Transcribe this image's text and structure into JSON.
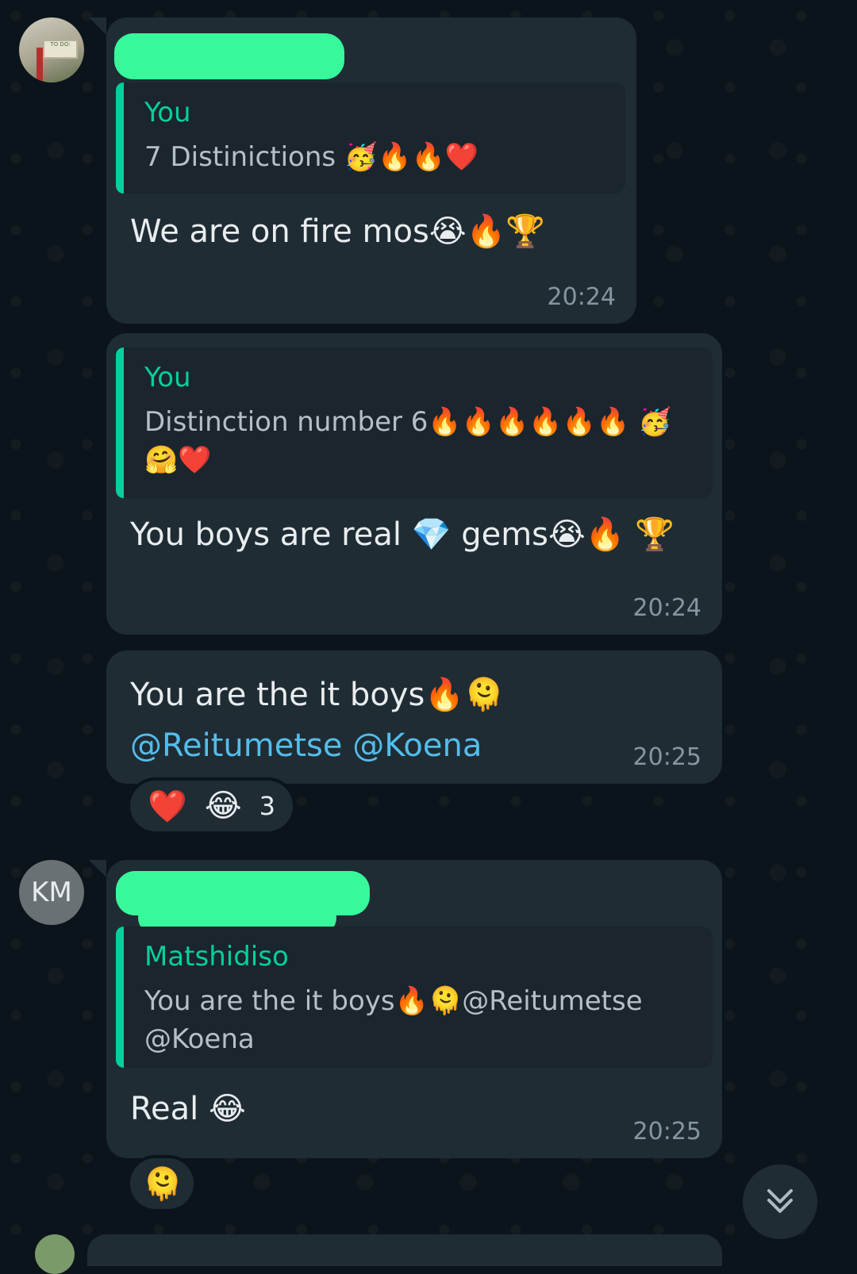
{
  "messages": [
    {
      "quote_author": "You",
      "quote_text": "7 Distinictions 🥳🔥🔥❤️",
      "text": "We are on fire mos😭🔥🏆",
      "time": "20:24"
    },
    {
      "quote_author": "You",
      "quote_text": "Distinction number 6🔥🔥🔥🔥🔥🔥 🥳🤗❤️",
      "text": "You boys are real 💎 gems😭🔥 🏆",
      "time": "20:24"
    },
    {
      "text_plain": "You are the it boys🔥🫠",
      "mentions": [
        "@Reitumetse",
        "@Koena"
      ],
      "time": "20:25",
      "reactions": {
        "emojis": [
          "❤️",
          "😂"
        ],
        "count": "3"
      }
    },
    {
      "avatar_initials": "KM",
      "quote_author": "Matshidiso",
      "quote_text": "You are the it boys🔥🫠@Reitumetse @Koena",
      "text": "Real 😂",
      "time": "20:25",
      "reactions": {
        "emojis": [
          "🫠"
        ]
      }
    }
  ],
  "avatar_sign_text": "TO DO:",
  "colors": {
    "background": "#0b141a",
    "bubble": "#1f2c34",
    "quote_bar": "#06cf9c",
    "mention": "#53bdeb",
    "redaction": "#37f99b"
  },
  "icons": {
    "scroll_down": "double-chevron-down-icon"
  }
}
